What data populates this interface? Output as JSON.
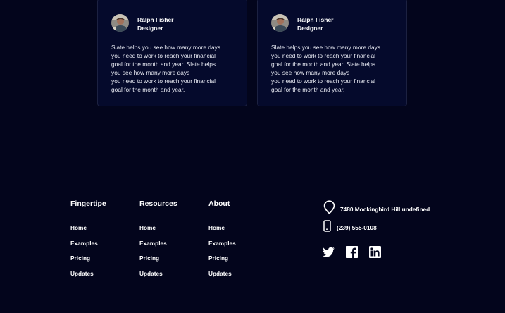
{
  "testimonials": [
    {
      "name": "Ralph Fisher",
      "role": "Designer",
      "text": "Slate helps you see how many more days\nyou need to work to reach your financial\ngoal for the month and year. Slate helps\nyou see how many more days\nyou need to work to reach your financial\ngoal for the month and year."
    },
    {
      "name": "Ralph Fisher",
      "role": "Designer",
      "text": "Slate helps you see how many more days\nyou need to work to reach your financial\ngoal for the month and year. Slate helps\nyou see how many more days\nyou need to work to reach your financial\ngoal for the month and year."
    }
  ],
  "footer": {
    "columns": [
      {
        "title": "Fingertipe",
        "links": [
          "Home",
          "Examples",
          "Pricing",
          "Updates"
        ]
      },
      {
        "title": "Resources",
        "links": [
          "Home",
          "Examples",
          "Pricing",
          "Updates"
        ]
      },
      {
        "title": "About",
        "links": [
          "Home",
          "Examples",
          "Pricing",
          "Updates"
        ]
      }
    ],
    "contact": {
      "address": "7480 Mockingbird Hill undefined",
      "phone": "(239) 555-0108"
    },
    "social": [
      {
        "icon": "twitter-icon"
      },
      {
        "icon": "facebook-icon"
      },
      {
        "icon": "linkedin-icon"
      }
    ]
  },
  "colors": {
    "background": "#03051c",
    "card_background": "#050a2c",
    "card_border": "#1c2141",
    "text": "#ffffff"
  }
}
